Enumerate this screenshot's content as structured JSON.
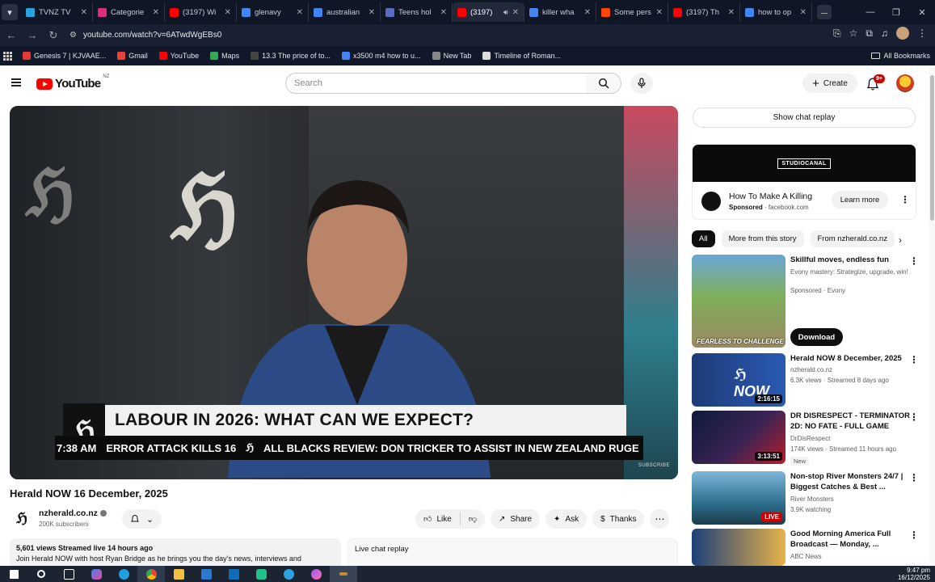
{
  "browser": {
    "tabs": [
      {
        "title": "TVNZ TV",
        "color": "#2aa3e0"
      },
      {
        "title": "Categorie",
        "color": "#d9307a"
      },
      {
        "title": "(3197) Wi",
        "color": "#ff0000"
      },
      {
        "title": "glenavy",
        "color": "#4285f4"
      },
      {
        "title": "australian",
        "color": "#4285f4"
      },
      {
        "title": "Teens hol",
        "color": "#5c6bc0"
      },
      {
        "title": "(3197)",
        "color": "#ff0000",
        "active": true
      },
      {
        "title": "killer wha",
        "color": "#4285f4"
      },
      {
        "title": "Some pers",
        "color": "#ff4500"
      },
      {
        "title": "(3197) Th",
        "color": "#ff0000"
      },
      {
        "title": "how to op",
        "color": "#4285f4"
      }
    ],
    "url": "youtube.com/watch?v=6ATwdWgEBs0",
    "bookmarks": [
      {
        "label": "Genesis 7 | KJVAAE...",
        "color": "#e53935"
      },
      {
        "label": "Gmail",
        "color": "#ea4335"
      },
      {
        "label": "YouTube",
        "color": "#ff0000"
      },
      {
        "label": "Maps",
        "color": "#34a853"
      },
      {
        "label": "13.3 The price of to...",
        "color": "#444"
      },
      {
        "label": "x3500 m4 how to u...",
        "color": "#4285f4"
      },
      {
        "label": "New Tab",
        "color": "#888"
      },
      {
        "label": "Timeline of Roman...",
        "color": "#ddd"
      }
    ],
    "all_bookmarks": "All Bookmarks"
  },
  "youtube": {
    "country": "NZ",
    "logo_text": "YouTube",
    "search_placeholder": "Search",
    "create_label": "Create",
    "notif_count": "9+"
  },
  "video": {
    "title": "Herald NOW 16 December, 2025",
    "lower_third": {
      "headline": "LABOUR IN 2026: WHAT CAN WE EXPECT?",
      "time": "7:38 AM",
      "ticker_1": "ERROR ATTACK KILLS 16",
      "ticker_2": "ALL BLACKS REVIEW: DON TRICKER TO ASSIST IN NEW ZEALAND RUGE"
    },
    "subscribe_mark": "SUBSCRIBE",
    "channel": {
      "name": "nzherald.co.nz",
      "subs": "200K subscribers"
    },
    "actions": {
      "like": "Like",
      "share": "Share",
      "ask": "Ask",
      "thanks": "Thanks"
    },
    "description": {
      "meta": "5,601 views  Streamed live 14 hours ago",
      "text": "Join Herald NOW with host Ryan Bridge as he brings you the day's news, interviews and"
    },
    "live_chat_replay": "Live chat replay"
  },
  "sidebar": {
    "show_chat": "Show chat replay",
    "ad": {
      "brand": "STUDIOCANAL",
      "title": "How To Make A Killing",
      "sponsored": "Sponsored",
      "domain": "facebook.com",
      "cta": "Learn more"
    },
    "chips": [
      "All",
      "More from this story",
      "From nzherald.co.nz"
    ],
    "recs": [
      {
        "title": "Skillful moves, endless fun",
        "channel": "Evony mastery: Strategize, upgrade, win!",
        "meta": "Sponsored · Evony",
        "cta": "Download",
        "thumb_text": "FEARLESS TO CHALLENGE"
      },
      {
        "title": "Herald NOW 8 December, 2025",
        "channel": "nzherald.co.nz",
        "meta": "6.3K views · Streamed 8 days ago",
        "duration": "2:16:15"
      },
      {
        "title": "DR DISRESPECT - TERMINATOR 2D: NO FATE - FULL GAME",
        "channel": "DrDisRespect",
        "meta": "174K views · Streamed 11 hours ago",
        "badge": "New",
        "duration": "3:13:51"
      },
      {
        "title": "Non-stop River Monsters 24/7 | Biggest Catches & Best ...",
        "channel": "River Monsters",
        "meta": "3.9K watching",
        "live": "LIVE"
      },
      {
        "title": "Good Morning America Full Broadcast — Monday, ...",
        "channel": "ABC News",
        "meta": ""
      }
    ]
  },
  "taskbar": {
    "time": "9:47 pm",
    "date": "16/12/2025"
  }
}
